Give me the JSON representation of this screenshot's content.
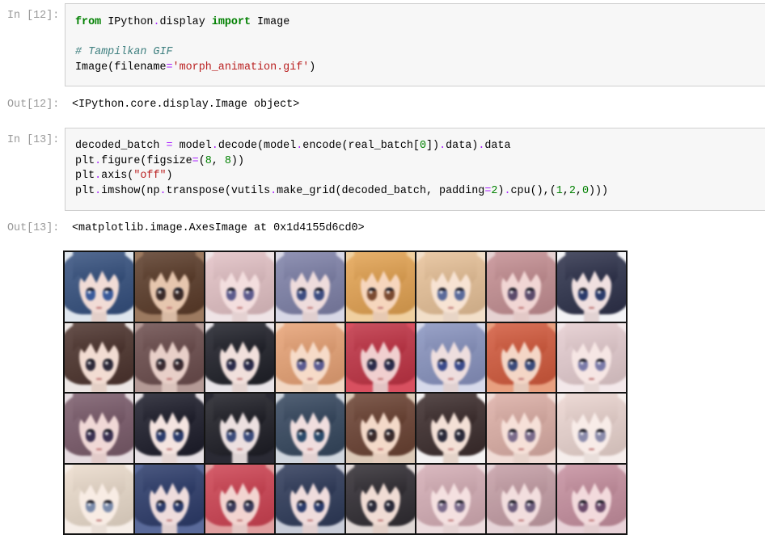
{
  "notebook": {
    "cells": [
      {
        "prompt_in": "In [12]:",
        "code_lines": [
          "from IPython.display import Image",
          "",
          "# Tampilkan GIF",
          "Image(filename='morph_animation.gif')"
        ],
        "prompt_out": "Out[12]:",
        "output_text": "<IPython.core.display.Image object>"
      },
      {
        "prompt_in": "In [13]:",
        "code_lines": [
          "decoded_batch = model.decode(model.encode(real_batch[0]).data).data",
          "plt.figure(figsize=(8, 8))",
          "plt.axis(\"off\")",
          "plt.imshow(np.transpose(vutils.make_grid(decoded_batch, padding=2).cpu(),(1,2,0)))"
        ],
        "prompt_out": "Out[13]:",
        "output_text": "<matplotlib.image.AxesImage at 0x1d4155d6cd0>",
        "output_image": {
          "tiles": [
            {
              "hair": "#34507f",
              "skin": "#f1dcd6",
              "eyes": "#3a5a9a",
              "bg": "#dfe6ee"
            },
            {
              "hair": "#5b3b28",
              "skin": "#e6c6ae",
              "eyes": "#3a2a28",
              "bg": "#9c7a60"
            },
            {
              "hair": "#e6c4c8",
              "skin": "#f3dede",
              "eyes": "#5c5a8c",
              "bg": "#efe4e6"
            },
            {
              "hair": "#7f82aa",
              "skin": "#eedcdc",
              "eyes": "#3d4c80",
              "bg": "#d8d8e6"
            },
            {
              "hair": "#e7a552",
              "skin": "#f6d6bd",
              "eyes": "#7a4a30",
              "bg": "#f0d0a0"
            },
            {
              "hair": "#ebc49a",
              "skin": "#f7e3d3",
              "eyes": "#5a6a9a",
              "bg": "#f2dfc9"
            },
            {
              "hair": "#c79094",
              "skin": "#f1d6d4",
              "eyes": "#5a4a6a",
              "bg": "#e6d2d2"
            },
            {
              "hair": "#2c304a",
              "skin": "#f0e0e0",
              "eyes": "#2a3a6a",
              "bg": "#f3f3f6"
            },
            {
              "hair": "#4c322c",
              "skin": "#f2dcd2",
              "eyes": "#2e2a3a",
              "bg": "#ece6e4"
            },
            {
              "hair": "#6c4c4c",
              "skin": "#e8cfc8",
              "eyes": "#3a2a30",
              "bg": "#b49a96"
            },
            {
              "hair": "#1d1e27",
              "skin": "#f1e0dc",
              "eyes": "#2a2a4a",
              "bg": "#e8e4e8"
            },
            {
              "hair": "#eba476",
              "skin": "#f6dbc8",
              "eyes": "#5a5a90",
              "bg": "#f2d8c4"
            },
            {
              "hair": "#c33244",
              "skin": "#f0cfcf",
              "eyes": "#2a2a4a",
              "bg": "#d85060"
            },
            {
              "hair": "#8a95c2",
              "skin": "#eedede",
              "eyes": "#3a4a8a",
              "bg": "#d6d9ea"
            },
            {
              "hair": "#d65a3c",
              "skin": "#f4d6c6",
              "eyes": "#3a4a7a",
              "bg": "#e8a080"
            },
            {
              "hair": "#e9d0d3",
              "skin": "#f6e6e4",
              "eyes": "#7a7aa8",
              "bg": "#f3e8ea"
            },
            {
              "hair": "#7b5b6b",
              "skin": "#f0d8d6",
              "eyes": "#3a3050",
              "bg": "#e6dce0"
            },
            {
              "hair": "#1b1b29",
              "skin": "#f4e4e0",
              "eyes": "#2a3a6a",
              "bg": "#e6e0e4"
            },
            {
              "hair": "#1c1c24",
              "skin": "#ece0e0",
              "eyes": "#3a4a7a",
              "bg": "#2a2a34"
            },
            {
              "hair": "#34465e",
              "skin": "#f0dede",
              "eyes": "#2a4a6a",
              "bg": "#d0d6de"
            },
            {
              "hair": "#6b4131",
              "skin": "#f3d9c8",
              "eyes": "#3a2a2a",
              "bg": "#dccab8"
            },
            {
              "hair": "#3b2b2b",
              "skin": "#f3e0d6",
              "eyes": "#2a2a3a",
              "bg": "#f4f2f2"
            },
            {
              "hair": "#e0b1a8",
              "skin": "#f6e0d8",
              "eyes": "#7a6a8a",
              "bg": "#f0dcd6"
            },
            {
              "hair": "#efd8d3",
              "skin": "#f8ece8",
              "eyes": "#8a8aaa",
              "bg": "#f6eeec"
            },
            {
              "hair": "#efdfcf",
              "skin": "#f8ece4",
              "eyes": "#7a8aaa",
              "bg": "#f6eee8"
            },
            {
              "hair": "#2b3b6b",
              "skin": "#eedcdc",
              "eyes": "#2a3a6a",
              "bg": "#5a6a9a"
            },
            {
              "hair": "#d14252",
              "skin": "#f2d4d0",
              "eyes": "#3a3a5a",
              "bg": "#e0a0a0"
            },
            {
              "hair": "#2d3959",
              "skin": "#efdcdc",
              "eyes": "#2a3a6a",
              "bg": "#c8ccd8"
            },
            {
              "hair": "#2f2b31",
              "skin": "#f0dcd4",
              "eyes": "#2a2a3a",
              "bg": "#e0d8d6"
            },
            {
              "hair": "#d8b0b8",
              "skin": "#f4e0e0",
              "eyes": "#7a6a8a",
              "bg": "#ecdcde"
            },
            {
              "hair": "#c8a0a8",
              "skin": "#f2dede",
              "eyes": "#6a5a7a",
              "bg": "#e6d4d8"
            },
            {
              "hair": "#c991a1",
              "skin": "#f2dadc",
              "eyes": "#6a4a6a",
              "bg": "#e8d2d8"
            }
          ]
        }
      }
    ]
  }
}
